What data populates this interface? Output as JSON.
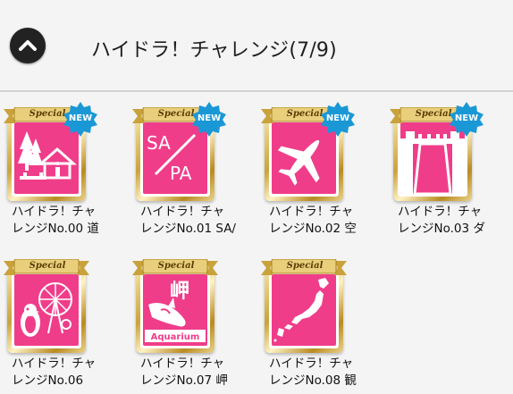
{
  "header": {
    "back_icon": "chevron-up-icon",
    "title": "ハイドラ！チャレンジ(7/9)"
  },
  "badge_texts": {
    "special": "Special",
    "new": "NEW"
  },
  "items": [
    {
      "line1": "ハイドラ！チャ",
      "line2": "レンジNo.00 道",
      "icon": "roadside-station-icon",
      "is_new": true
    },
    {
      "line1": "ハイドラ！チャ",
      "line2": "レンジNo.01 SA/",
      "icon": "sa-pa-icon",
      "icon_text_1": "SA",
      "icon_text_2": "PA",
      "is_new": true
    },
    {
      "line1": "ハイドラ！チャ",
      "line2": "レンジNo.02 空",
      "icon": "airplane-icon",
      "is_new": true
    },
    {
      "line1": "ハイドラ！チャ",
      "line2": "レンジNo.03 ダ",
      "icon": "dam-icon",
      "is_new": true
    },
    {
      "line1": "ハイドラ！チャ",
      "line2": "レンジNo.06",
      "icon": "penguin-ferris-wheel-icon",
      "is_new": false
    },
    {
      "line1": "ハイドラ！チャ",
      "line2": "レンジNo.07 岬",
      "icon": "aquarium-orca-icon",
      "icon_text_1": "岬",
      "icon_text_2": "Aquarium",
      "is_new": false
    },
    {
      "line1": "ハイドラ！チャ",
      "line2": "レンジNo.08 観",
      "icon": "japan-map-icon",
      "is_new": false
    }
  ]
}
